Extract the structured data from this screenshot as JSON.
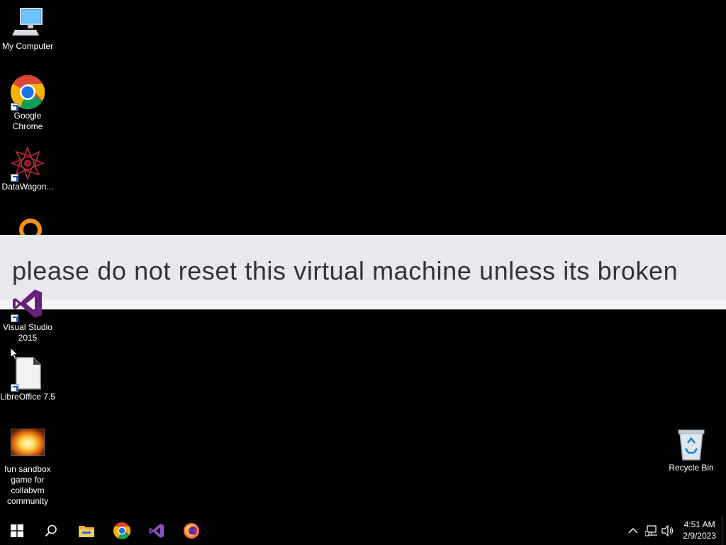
{
  "desktop": {
    "icons": [
      {
        "name": "my-computer-icon",
        "label": "My Computer"
      },
      {
        "name": "google-chrome-icon",
        "label": "Google Chrome"
      },
      {
        "name": "datawagon-icon",
        "label": "DataWagon..."
      },
      {
        "name": "search-tool-icon",
        "label": ""
      },
      {
        "name": "visual-studio-icon",
        "label": "Visual Studio 2015"
      },
      {
        "name": "libreoffice-icon",
        "label": "LibreOffice 7.5"
      },
      {
        "name": "sandbox-game-icon",
        "label": "fun sandbox game for collabvm community"
      },
      {
        "name": "recycle-bin-icon",
        "label": "Recycle Bin"
      }
    ]
  },
  "banner": {
    "text": "please do not reset this virtual machine unless its broken"
  },
  "taskbar": {
    "pinned": [
      "start-icon",
      "search-icon",
      "file-explorer-icon",
      "chrome-icon",
      "visual-studio-icon",
      "firefox-icon"
    ],
    "tray_icons": [
      "chevron-up-icon",
      "network-icon",
      "volume-icon"
    ],
    "time": "4:51 AM",
    "date": "2/9/2023"
  },
  "colors": {
    "desktop_bg": "#000000",
    "banner_bg": "#e9e8ee",
    "banner_text": "#333333",
    "vs_purple": "#68217a",
    "chrome_blue": "#1a73e8"
  }
}
